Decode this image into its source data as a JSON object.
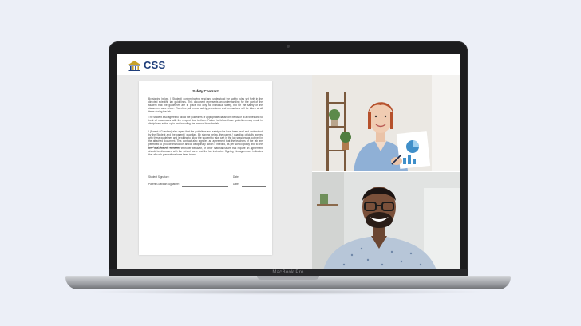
{
  "device": {
    "label": "MacBook Pro"
  },
  "app": {
    "logo_text": "CSS",
    "colors": {
      "brand": "#1f3e7a",
      "logo_mark": "#c9a227"
    }
  },
  "document": {
    "title": "Safety Contract",
    "paragraphs": [
      "By signing below, I (Student) confirm having read and understood the safety rules set forth in the directed scientific lab guidelines. This document represents an understanding for the part of the student that the guidelines are in place not only for individual safety, but for the safety of the classroom as a whole. Therefore, all proper safety procedures and precautions will be taken at all times during the lab.",
      "The student also agrees to follow the guidelines of appropriate classroom behavior at all times and to treat all classmates with the respect due to them. Failure to follow these guidelines may result in disciplinary action up to and including the removal from the lab.",
      "I (Parent / Guardian) also agree that the guidelines and safety rules have been read and understood by the Student and the parent / guardian. By signing below, the parent / guardian officially agrees with these guidelines and is willing to allow the student to take part in the lab sessions as outlined in the attached document. This contract also signifies an agreement that the teachers of the lab are permitted to provide instruction and/or disciplinary action if needed, as per school policy and to the teachers' desire if necessary.",
      "Any unauthorized behavior, improper behavior, or other material issues that require an agreement should be discussed with the school nurse and the lab instructor. Signing this agreement indicates that all such precautions have been taken."
    ],
    "signatures": [
      {
        "label": "Student Signature:",
        "date_label": "Date:"
      },
      {
        "label": "Parent/Guardian Signature:",
        "date_label": "Date:"
      }
    ]
  },
  "participants": [
    {
      "name": "",
      "icon": "woman-presenter-video"
    },
    {
      "name": "",
      "icon": "man-smiling-video"
    }
  ]
}
